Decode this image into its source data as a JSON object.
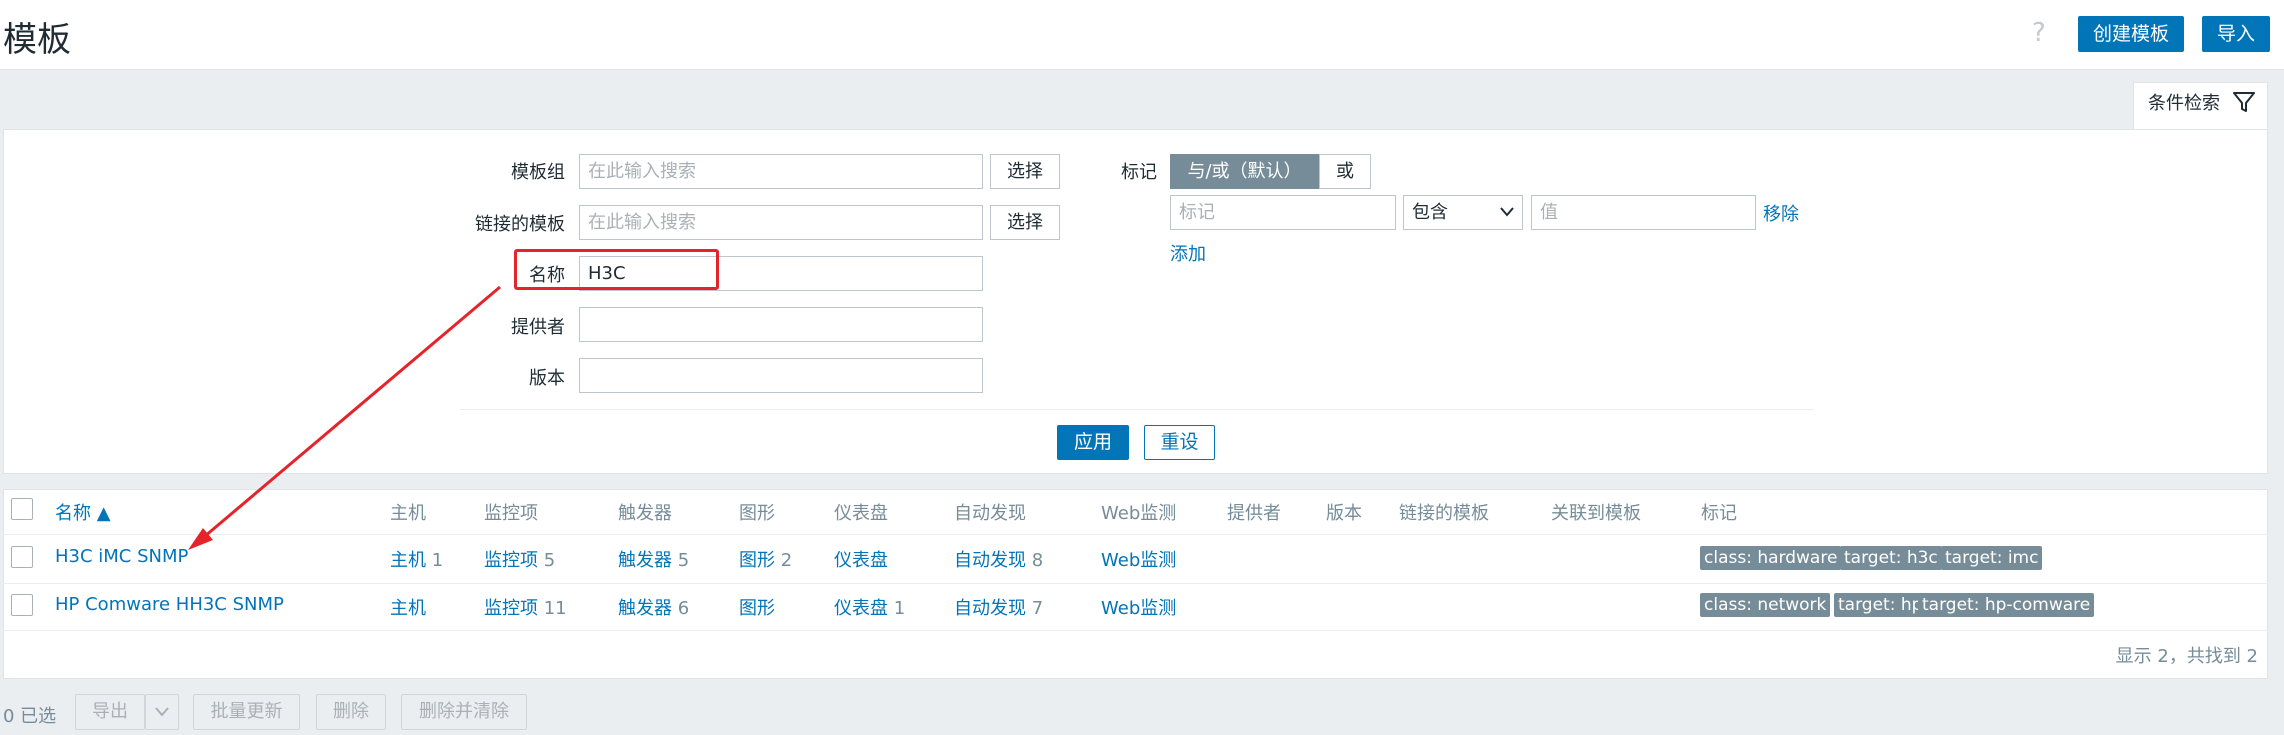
{
  "header": {
    "title": "模板",
    "help": "?",
    "create_label": "创建模板",
    "import_label": "导入"
  },
  "filter": {
    "tab_label": "条件检索",
    "template_group": {
      "label": "模板组",
      "placeholder": "在此输入搜索",
      "select_label": "选择"
    },
    "linked_templates": {
      "label": "链接的模板",
      "placeholder": "在此输入搜索",
      "select_label": "选择"
    },
    "name": {
      "label": "名称",
      "value": "H3C"
    },
    "vendor": {
      "label": "提供者",
      "value": ""
    },
    "version": {
      "label": "版本",
      "value": ""
    },
    "tags": {
      "label": "标记",
      "mode_and_or": "与/或（默认）",
      "mode_or": "或",
      "tag_placeholder": "标记",
      "operator": "包含",
      "value_placeholder": "值",
      "remove_label": "移除",
      "add_label": "添加"
    },
    "apply_label": "应用",
    "reset_label": "重设"
  },
  "table": {
    "headers": {
      "name": "名称 ▲",
      "hosts": "主机",
      "items": "监控项",
      "triggers": "触发器",
      "graphs": "图形",
      "dashboards": "仪表盘",
      "discovery": "自动发现",
      "web": "Web监测",
      "vendor": "提供者",
      "version": "版本",
      "linked": "链接的模板",
      "linked_to": "关联到模板",
      "tags": "标记"
    },
    "rows": [
      {
        "name": "H3C iMC SNMP",
        "hosts": "主机",
        "hosts_n": "1",
        "items": "监控项",
        "items_n": "5",
        "triggers": "触发器",
        "triggers_n": "5",
        "graphs": "图形",
        "graphs_n": "2",
        "dashboards": "仪表盘",
        "dashboards_n": "",
        "discovery": "自动发现",
        "discovery_n": "8",
        "web": "Web监测",
        "tags": [
          "class: hardware",
          "target: h3c",
          "target: imc"
        ]
      },
      {
        "name": "HP Comware HH3C SNMP",
        "hosts": "主机",
        "hosts_n": "",
        "items": "监控项",
        "items_n": "11",
        "triggers": "触发器",
        "triggers_n": "6",
        "graphs": "图形",
        "graphs_n": "",
        "dashboards": "仪表盘",
        "dashboards_n": "1",
        "discovery": "自动发现",
        "discovery_n": "7",
        "web": "Web监测",
        "tags": [
          "class: network",
          "target: hp",
          "target: hp-comware"
        ]
      }
    ],
    "summary": "显示 2，共找到 2"
  },
  "footer": {
    "selected": "0 已选",
    "export_label": "导出",
    "mass_update_label": "批量更新",
    "delete_label": "删除",
    "delete_clear_label": "删除并清除"
  },
  "colors": {
    "accent": "#0275b8",
    "tag_bg": "#768d99",
    "annotation": "#e4232a"
  }
}
